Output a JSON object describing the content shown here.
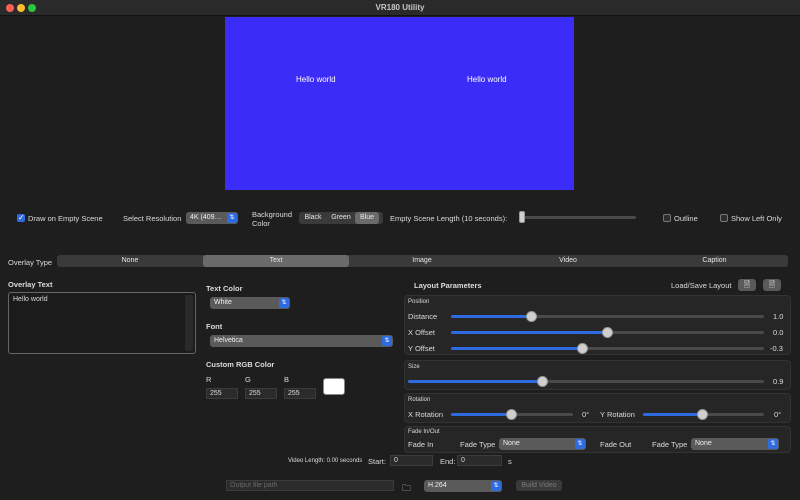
{
  "window": {
    "title": "VR180 Utility"
  },
  "preview": {
    "left_text": "Hello world",
    "right_text": "Hello world",
    "background_color": "#3b2cf8"
  },
  "toolbar": {
    "draw_empty_label": "Draw on Empty Scene",
    "draw_empty_checked": true,
    "resolution_label": "Select Resolution",
    "resolution_value": "4K (409…",
    "background_color_label": "Background Color",
    "bg_options": [
      "Black",
      "Green",
      "Blue"
    ],
    "bg_selected": "Blue",
    "scene_length_label": "Empty Scene Length (10 seconds):",
    "outline_label": "Outline",
    "show_left_only_label": "Show Left Only"
  },
  "overlay": {
    "type_label": "Overlay Type",
    "types": [
      "None",
      "Text",
      "Image",
      "Video",
      "Caption"
    ],
    "selected": "Text"
  },
  "text_panel": {
    "overlay_text_label": "Overlay Text",
    "overlay_text_value": "Hello world",
    "text_color_label": "Text Color",
    "text_color_value": "White",
    "font_label": "Font",
    "font_value": "Helvetica",
    "custom_rgb_label": "Custom RGB Color",
    "r_label": "R",
    "g_label": "G",
    "b_label": "B",
    "r_value": "255",
    "g_value": "255",
    "b_value": "255",
    "swatch_color": "#ffffff"
  },
  "layout": {
    "title": "Layout Parameters",
    "load_save_label": "Load/Save Layout",
    "position_label": "Position",
    "distance_label": "Distance",
    "distance_value": "1.0",
    "distance_fraction": 0.26,
    "xoffset_label": "X Offset",
    "xoffset_value": "0.0",
    "xoffset_fraction": 0.5,
    "yoffset_label": "Y Offset",
    "yoffset_value": "-0.3",
    "yoffset_fraction": 0.42,
    "size_label": "Size",
    "size_value": "0.9",
    "size_fraction": 0.38,
    "rotation_label": "Rotation",
    "xrot_label": "X Rotation",
    "xrot_value": "0°",
    "xrot_fraction": 0.5,
    "yrot_label": "Y Rotation",
    "yrot_value": "0°",
    "yrot_fraction": 0.5,
    "fade_label": "Fade In/Out",
    "fade_in_label": "Fade In",
    "fade_in_type_label": "Fade Type",
    "fade_in_type_value": "None",
    "fade_out_label": "Fade Out",
    "fade_out_type_label": "Fade Type",
    "fade_out_type_value": "None"
  },
  "video": {
    "length_label": "Video Length: 0.00 seconds",
    "start_label": "Start:",
    "start_value": "0",
    "end_label": "End:",
    "end_value": "0",
    "seconds_unit": "s"
  },
  "footer": {
    "output_placeholder": "Output file path",
    "codec_value": "H.264",
    "build_label": "Build Video"
  },
  "icons": {
    "folder": "folder-icon",
    "doc": "document-icon",
    "chevron": "chevron-updown-icon"
  }
}
